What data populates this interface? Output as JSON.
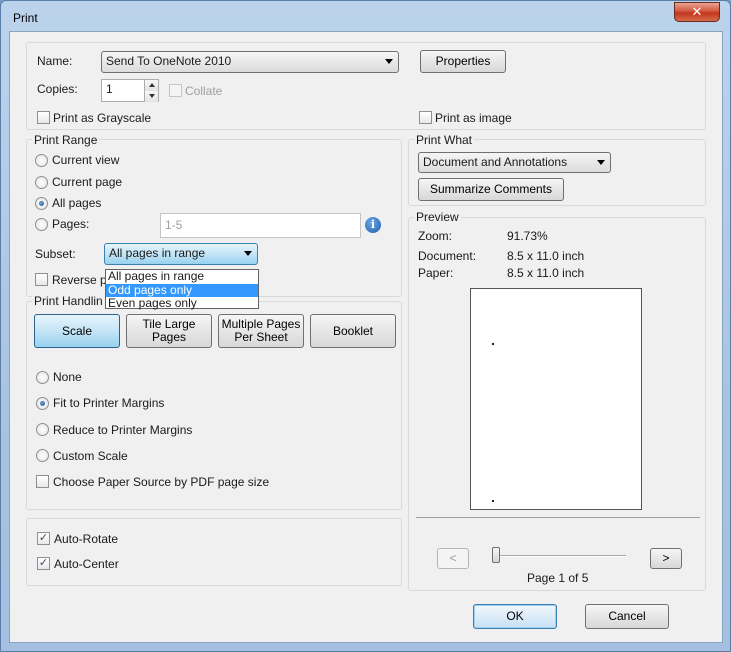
{
  "window": {
    "title": "Print",
    "close_glyph": "✕"
  },
  "printer": {
    "name_label": "Name:",
    "name_value": "Send To OneNote 2010",
    "properties_label": "Properties",
    "copies_label": "Copies:",
    "copies_value": "1",
    "collate_label": "Collate",
    "grayscale_label": "Print as Grayscale",
    "print_image_label": "Print as image"
  },
  "print_range": {
    "title": "Print Range",
    "current_view": "Current view",
    "current_page": "Current page",
    "all_pages": "All pages",
    "pages_label": "Pages:",
    "pages_value": "1-5",
    "info_glyph": "i",
    "subset_label": "Subset:",
    "subset_value": "All pages in range",
    "subset_options": [
      "All pages in range",
      "Odd pages only",
      "Even pages only"
    ],
    "reverse_label": "Reverse p"
  },
  "print_handling": {
    "title": "Print Handlin",
    "scale": "Scale",
    "tile_line1": "Tile Large",
    "tile_line2": "Pages",
    "multi_line1": "Multiple Pages",
    "multi_line2": "Per Sheet",
    "booklet": "Booklet",
    "none": "None",
    "fit": "Fit to Printer Margins",
    "reduce": "Reduce to Printer Margins",
    "custom": "Custom Scale",
    "paper_source": "Choose Paper Source by PDF page size",
    "auto_rotate": "Auto-Rotate",
    "auto_center": "Auto-Center"
  },
  "print_what": {
    "title": "Print What",
    "value": "Document and Annotations",
    "summarize": "Summarize Comments"
  },
  "preview": {
    "title": "Preview",
    "zoom_label": "Zoom:",
    "zoom_value": "91.73%",
    "document_label": "Document:",
    "document_value": "8.5 x 11.0 inch",
    "paper_label": "Paper:",
    "paper_value": "8.5 x 11.0 inch",
    "prev": "<",
    "next": ">",
    "page_status": "Page 1 of 5"
  },
  "footer": {
    "ok": "OK",
    "cancel": "Cancel"
  },
  "checks": {
    "mark": "✓"
  }
}
